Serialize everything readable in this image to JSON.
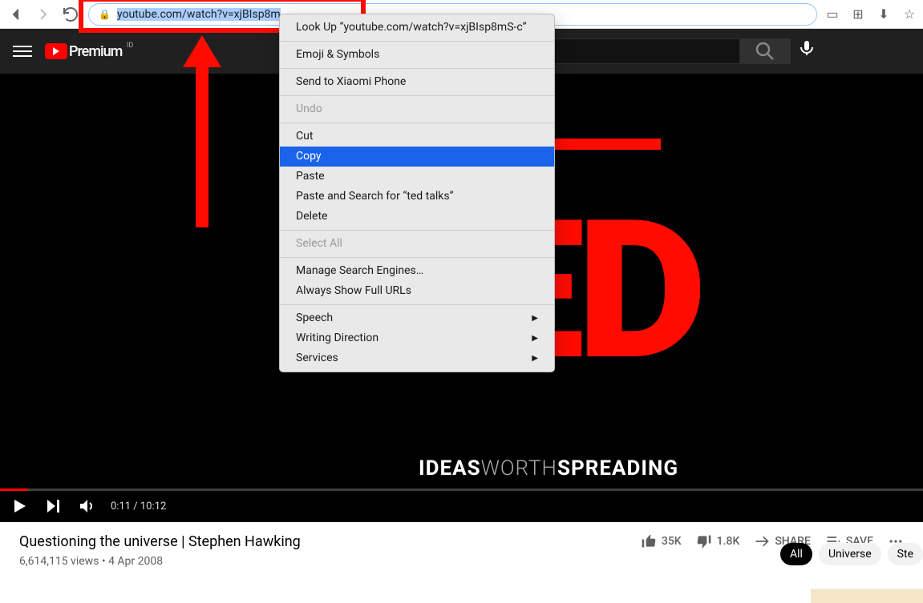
{
  "browser": {
    "url_selected": "youtube.com/watch?v=xjBIsp8m",
    "url_rest": ""
  },
  "context_menu": {
    "lookup": "Look Up “youtube.com/watch?v=xjBIsp8mS-c”",
    "emoji": "Emoji & Symbols",
    "xiaomi": "Send to Xiaomi Phone",
    "undo": "Undo",
    "cut": "Cut",
    "copy": "Copy",
    "paste": "Paste",
    "paste_search": "Paste and Search for “ted talks”",
    "delete": "Delete",
    "select_all": "Select All",
    "manage_engines": "Manage Search Engines…",
    "always_full_urls": "Always Show Full URLs",
    "speech": "Speech",
    "writing_direction": "Writing Direction",
    "services": "Services"
  },
  "masthead": {
    "logo_text": "Premium",
    "logo_sup": "ID",
    "search_placeholder": "Search"
  },
  "video": {
    "ted_text": "TED",
    "tagline_ideas": "IDEAS",
    "tagline_worth": "WORTH",
    "tagline_spreading": "SPREADING",
    "time": "0:11 / 10:12"
  },
  "info": {
    "title": "Questioning the universe | Stephen Hawking",
    "meta": "6,614,115 views • 4 Apr 2008",
    "likes": "35K",
    "dislikes": "1.8K",
    "share": "SHARE",
    "save": "SAVE"
  },
  "chips": {
    "all": "All",
    "universe": "Universe",
    "ste": "Ste"
  }
}
